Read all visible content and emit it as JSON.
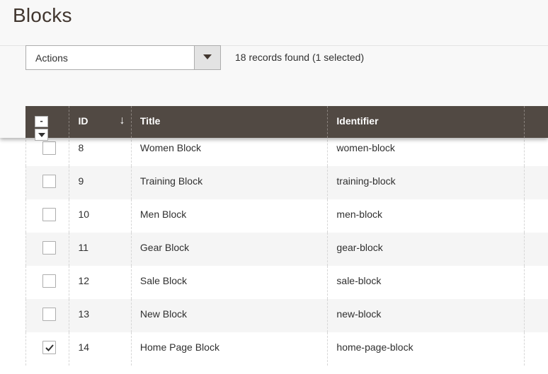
{
  "page": {
    "title": "Blocks"
  },
  "toolbar": {
    "actions_label": "Actions",
    "records_text": "18 records found (1 selected)"
  },
  "grid": {
    "columns": {
      "mass_select": "-",
      "id": "ID",
      "title": "Title",
      "identifier": "Identifier"
    },
    "sort_icon": "↓",
    "rows": [
      {
        "id": "8",
        "title": "Women Block",
        "identifier": "women-block",
        "checked": false
      },
      {
        "id": "9",
        "title": "Training Block",
        "identifier": "training-block",
        "checked": false
      },
      {
        "id": "10",
        "title": "Men Block",
        "identifier": "men-block",
        "checked": false
      },
      {
        "id": "11",
        "title": "Gear Block",
        "identifier": "gear-block",
        "checked": false
      },
      {
        "id": "12",
        "title": "Sale Block",
        "identifier": "sale-block",
        "checked": false
      },
      {
        "id": "13",
        "title": "New Block",
        "identifier": "new-block",
        "checked": false
      },
      {
        "id": "14",
        "title": "Home Page Block",
        "identifier": "home-page-block",
        "checked": true
      }
    ]
  },
  "colors": {
    "header_bg": "#514943",
    "title_color": "#41362f",
    "row_alt": "#f5f5f5"
  }
}
